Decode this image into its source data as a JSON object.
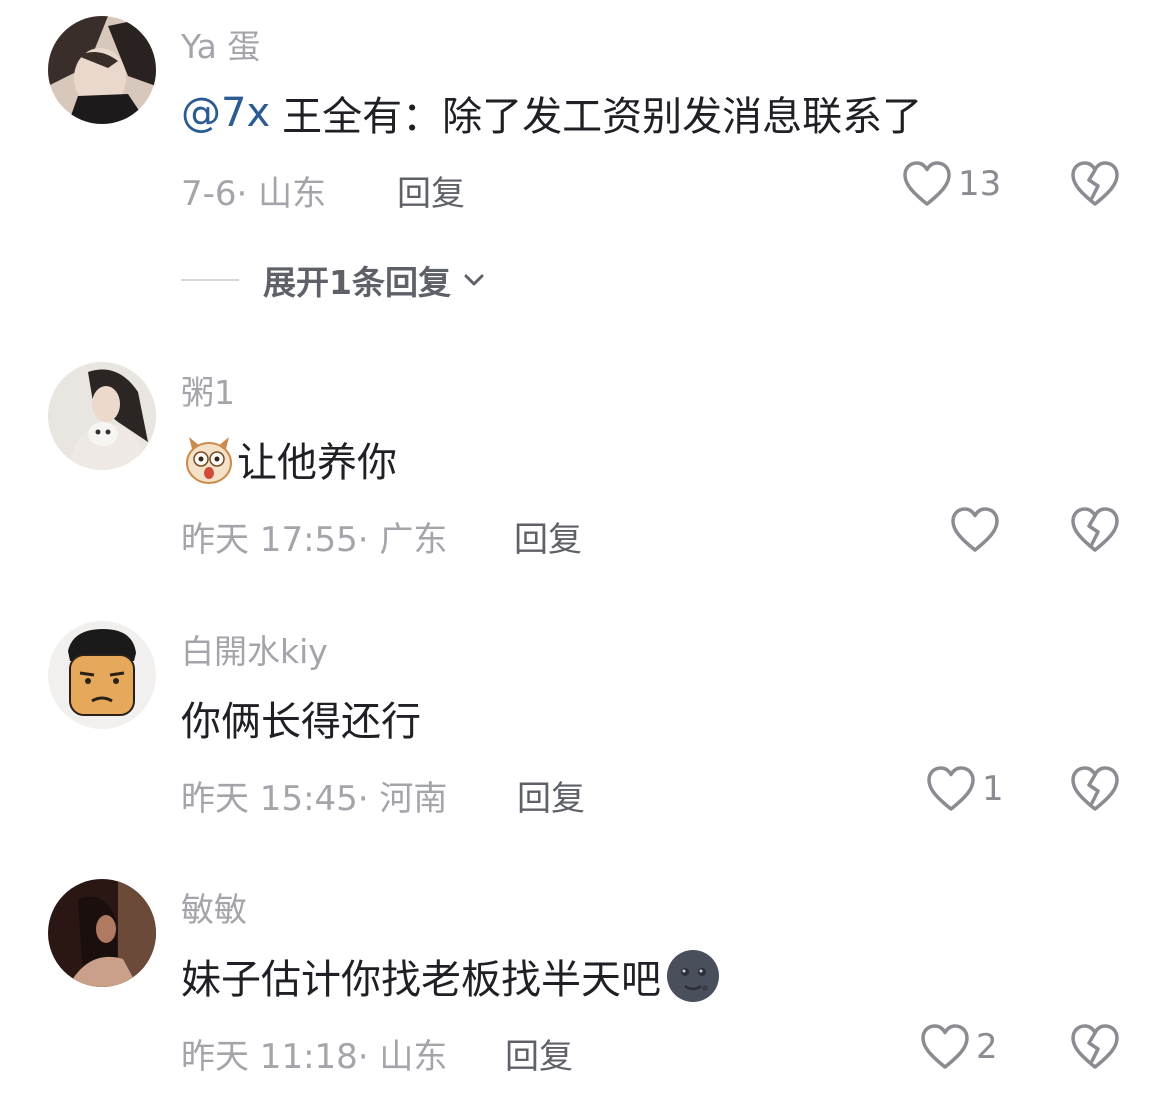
{
  "comments": [
    {
      "username": "Ya 蛋",
      "mention": "@7x",
      "text": "王全有：除了发工资别发消息联系了",
      "time_location": "7-6· 山东",
      "reply_label": "回复",
      "like_count": "13",
      "expand_label": "展开1条回复"
    },
    {
      "username": "粥1",
      "text": "让他养你",
      "time_location": "昨天 17:55· 广东",
      "reply_label": "回复",
      "like_count": ""
    },
    {
      "username": "白開水kiy",
      "text": "你俩长得还行",
      "time_location": "昨天 15:45· 河南",
      "reply_label": "回复",
      "like_count": "1"
    },
    {
      "username": "敏敏",
      "text": "妹子估计你找老板找半天吧",
      "time_location": "昨天 11:18· 山东",
      "reply_label": "回复",
      "like_count": "2"
    }
  ],
  "icons": {
    "like": "heart-outline-icon",
    "dislike": "broken-heart-icon",
    "expand": "chevron-down-icon"
  },
  "colors": {
    "mention": "#2a5c93",
    "muted": "#a3a5ab",
    "text": "#1f1f25"
  }
}
